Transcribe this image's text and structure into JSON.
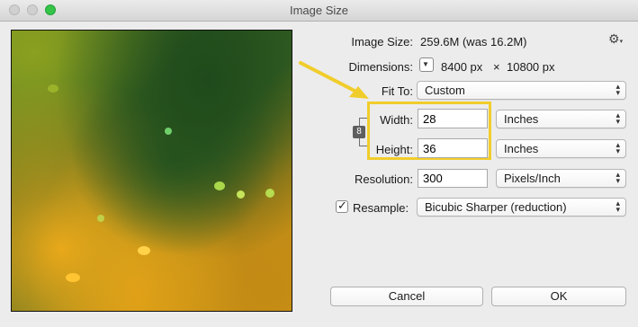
{
  "window": {
    "title": "Image Size"
  },
  "image_size": {
    "label": "Image Size:",
    "value": "259.6M (was 16.2M)"
  },
  "dimensions": {
    "label": "Dimensions:",
    "width": "8400 px",
    "separator": "×",
    "height": "10800 px"
  },
  "fit_to": {
    "label": "Fit To:",
    "value": "Custom"
  },
  "width": {
    "label": "Width:",
    "value": "28",
    "unit": "Inches"
  },
  "height": {
    "label": "Height:",
    "value": "36",
    "unit": "Inches"
  },
  "resolution": {
    "label": "Resolution:",
    "value": "300",
    "unit": "Pixels/Inch"
  },
  "resample": {
    "label": "Resample:",
    "checked": true,
    "checkmark": "✓",
    "value": "Bicubic Sharper (reduction)"
  },
  "buttons": {
    "cancel": "Cancel",
    "ok": "OK"
  },
  "icons": {
    "settings": "gear-icon",
    "link": "chain-link-icon",
    "dimensions_menu": "triangle-down-icon",
    "popup": "up-down-arrows-icon"
  },
  "colors": {
    "highlight": "#f1cd2b",
    "arrow": "#f1cd2b",
    "maximize": "#35c348"
  }
}
